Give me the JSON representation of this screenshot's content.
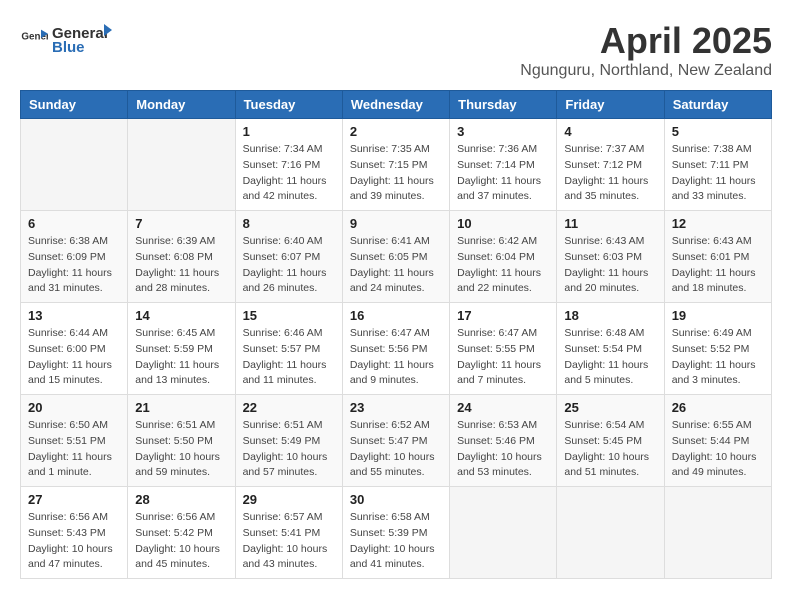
{
  "header": {
    "logo_general": "General",
    "logo_blue": "Blue",
    "title": "April 2025",
    "subtitle": "Ngunguru, Northland, New Zealand"
  },
  "weekdays": [
    "Sunday",
    "Monday",
    "Tuesday",
    "Wednesday",
    "Thursday",
    "Friday",
    "Saturday"
  ],
  "weeks": [
    [
      {
        "day": "",
        "sunrise": "",
        "sunset": "",
        "daylight": ""
      },
      {
        "day": "",
        "sunrise": "",
        "sunset": "",
        "daylight": ""
      },
      {
        "day": "1",
        "sunrise": "Sunrise: 7:34 AM",
        "sunset": "Sunset: 7:16 PM",
        "daylight": "Daylight: 11 hours and 42 minutes."
      },
      {
        "day": "2",
        "sunrise": "Sunrise: 7:35 AM",
        "sunset": "Sunset: 7:15 PM",
        "daylight": "Daylight: 11 hours and 39 minutes."
      },
      {
        "day": "3",
        "sunrise": "Sunrise: 7:36 AM",
        "sunset": "Sunset: 7:14 PM",
        "daylight": "Daylight: 11 hours and 37 minutes."
      },
      {
        "day": "4",
        "sunrise": "Sunrise: 7:37 AM",
        "sunset": "Sunset: 7:12 PM",
        "daylight": "Daylight: 11 hours and 35 minutes."
      },
      {
        "day": "5",
        "sunrise": "Sunrise: 7:38 AM",
        "sunset": "Sunset: 7:11 PM",
        "daylight": "Daylight: 11 hours and 33 minutes."
      }
    ],
    [
      {
        "day": "6",
        "sunrise": "Sunrise: 6:38 AM",
        "sunset": "Sunset: 6:09 PM",
        "daylight": "Daylight: 11 hours and 31 minutes."
      },
      {
        "day": "7",
        "sunrise": "Sunrise: 6:39 AM",
        "sunset": "Sunset: 6:08 PM",
        "daylight": "Daylight: 11 hours and 28 minutes."
      },
      {
        "day": "8",
        "sunrise": "Sunrise: 6:40 AM",
        "sunset": "Sunset: 6:07 PM",
        "daylight": "Daylight: 11 hours and 26 minutes."
      },
      {
        "day": "9",
        "sunrise": "Sunrise: 6:41 AM",
        "sunset": "Sunset: 6:05 PM",
        "daylight": "Daylight: 11 hours and 24 minutes."
      },
      {
        "day": "10",
        "sunrise": "Sunrise: 6:42 AM",
        "sunset": "Sunset: 6:04 PM",
        "daylight": "Daylight: 11 hours and 22 minutes."
      },
      {
        "day": "11",
        "sunrise": "Sunrise: 6:43 AM",
        "sunset": "Sunset: 6:03 PM",
        "daylight": "Daylight: 11 hours and 20 minutes."
      },
      {
        "day": "12",
        "sunrise": "Sunrise: 6:43 AM",
        "sunset": "Sunset: 6:01 PM",
        "daylight": "Daylight: 11 hours and 18 minutes."
      }
    ],
    [
      {
        "day": "13",
        "sunrise": "Sunrise: 6:44 AM",
        "sunset": "Sunset: 6:00 PM",
        "daylight": "Daylight: 11 hours and 15 minutes."
      },
      {
        "day": "14",
        "sunrise": "Sunrise: 6:45 AM",
        "sunset": "Sunset: 5:59 PM",
        "daylight": "Daylight: 11 hours and 13 minutes."
      },
      {
        "day": "15",
        "sunrise": "Sunrise: 6:46 AM",
        "sunset": "Sunset: 5:57 PM",
        "daylight": "Daylight: 11 hours and 11 minutes."
      },
      {
        "day": "16",
        "sunrise": "Sunrise: 6:47 AM",
        "sunset": "Sunset: 5:56 PM",
        "daylight": "Daylight: 11 hours and 9 minutes."
      },
      {
        "day": "17",
        "sunrise": "Sunrise: 6:47 AM",
        "sunset": "Sunset: 5:55 PM",
        "daylight": "Daylight: 11 hours and 7 minutes."
      },
      {
        "day": "18",
        "sunrise": "Sunrise: 6:48 AM",
        "sunset": "Sunset: 5:54 PM",
        "daylight": "Daylight: 11 hours and 5 minutes."
      },
      {
        "day": "19",
        "sunrise": "Sunrise: 6:49 AM",
        "sunset": "Sunset: 5:52 PM",
        "daylight": "Daylight: 11 hours and 3 minutes."
      }
    ],
    [
      {
        "day": "20",
        "sunrise": "Sunrise: 6:50 AM",
        "sunset": "Sunset: 5:51 PM",
        "daylight": "Daylight: 11 hours and 1 minute."
      },
      {
        "day": "21",
        "sunrise": "Sunrise: 6:51 AM",
        "sunset": "Sunset: 5:50 PM",
        "daylight": "Daylight: 10 hours and 59 minutes."
      },
      {
        "day": "22",
        "sunrise": "Sunrise: 6:51 AM",
        "sunset": "Sunset: 5:49 PM",
        "daylight": "Daylight: 10 hours and 57 minutes."
      },
      {
        "day": "23",
        "sunrise": "Sunrise: 6:52 AM",
        "sunset": "Sunset: 5:47 PM",
        "daylight": "Daylight: 10 hours and 55 minutes."
      },
      {
        "day": "24",
        "sunrise": "Sunrise: 6:53 AM",
        "sunset": "Sunset: 5:46 PM",
        "daylight": "Daylight: 10 hours and 53 minutes."
      },
      {
        "day": "25",
        "sunrise": "Sunrise: 6:54 AM",
        "sunset": "Sunset: 5:45 PM",
        "daylight": "Daylight: 10 hours and 51 minutes."
      },
      {
        "day": "26",
        "sunrise": "Sunrise: 6:55 AM",
        "sunset": "Sunset: 5:44 PM",
        "daylight": "Daylight: 10 hours and 49 minutes."
      }
    ],
    [
      {
        "day": "27",
        "sunrise": "Sunrise: 6:56 AM",
        "sunset": "Sunset: 5:43 PM",
        "daylight": "Daylight: 10 hours and 47 minutes."
      },
      {
        "day": "28",
        "sunrise": "Sunrise: 6:56 AM",
        "sunset": "Sunset: 5:42 PM",
        "daylight": "Daylight: 10 hours and 45 minutes."
      },
      {
        "day": "29",
        "sunrise": "Sunrise: 6:57 AM",
        "sunset": "Sunset: 5:41 PM",
        "daylight": "Daylight: 10 hours and 43 minutes."
      },
      {
        "day": "30",
        "sunrise": "Sunrise: 6:58 AM",
        "sunset": "Sunset: 5:39 PM",
        "daylight": "Daylight: 10 hours and 41 minutes."
      },
      {
        "day": "",
        "sunrise": "",
        "sunset": "",
        "daylight": ""
      },
      {
        "day": "",
        "sunrise": "",
        "sunset": "",
        "daylight": ""
      },
      {
        "day": "",
        "sunrise": "",
        "sunset": "",
        "daylight": ""
      }
    ]
  ]
}
